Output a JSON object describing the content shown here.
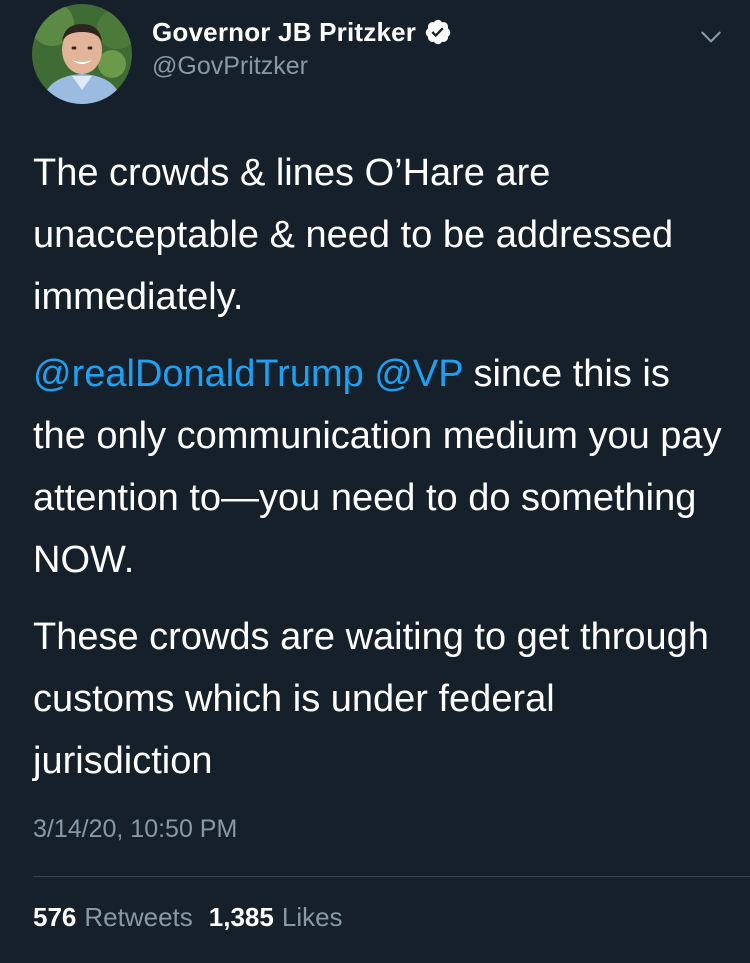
{
  "author": {
    "display_name": "Governor JB Pritzker",
    "handle": "@GovPritzker",
    "verified": true,
    "avatar_icon": "profile-photo"
  },
  "tweet": {
    "paragraph_1": "The crowds & lines O’Hare are unacceptable & need to be addressed immediately.",
    "mention_1": "@realDonaldTrump",
    "mention_2": "@VP",
    "paragraph_2_rest": " since this is the only communication medium you pay attention to—you need to do something NOW.",
    "paragraph_3": "These crowds are waiting to get through customs which is under federal jurisdiction",
    "timestamp": "3/14/20, 10:50 PM"
  },
  "stats": {
    "retweets_count": "576",
    "retweets_label": "Retweets",
    "likes_count": "1,385",
    "likes_label": "Likes"
  },
  "colors": {
    "background": "#15202b",
    "mention": "#1da1f2",
    "secondary_text": "#8899a6",
    "divider": "#38444d"
  }
}
